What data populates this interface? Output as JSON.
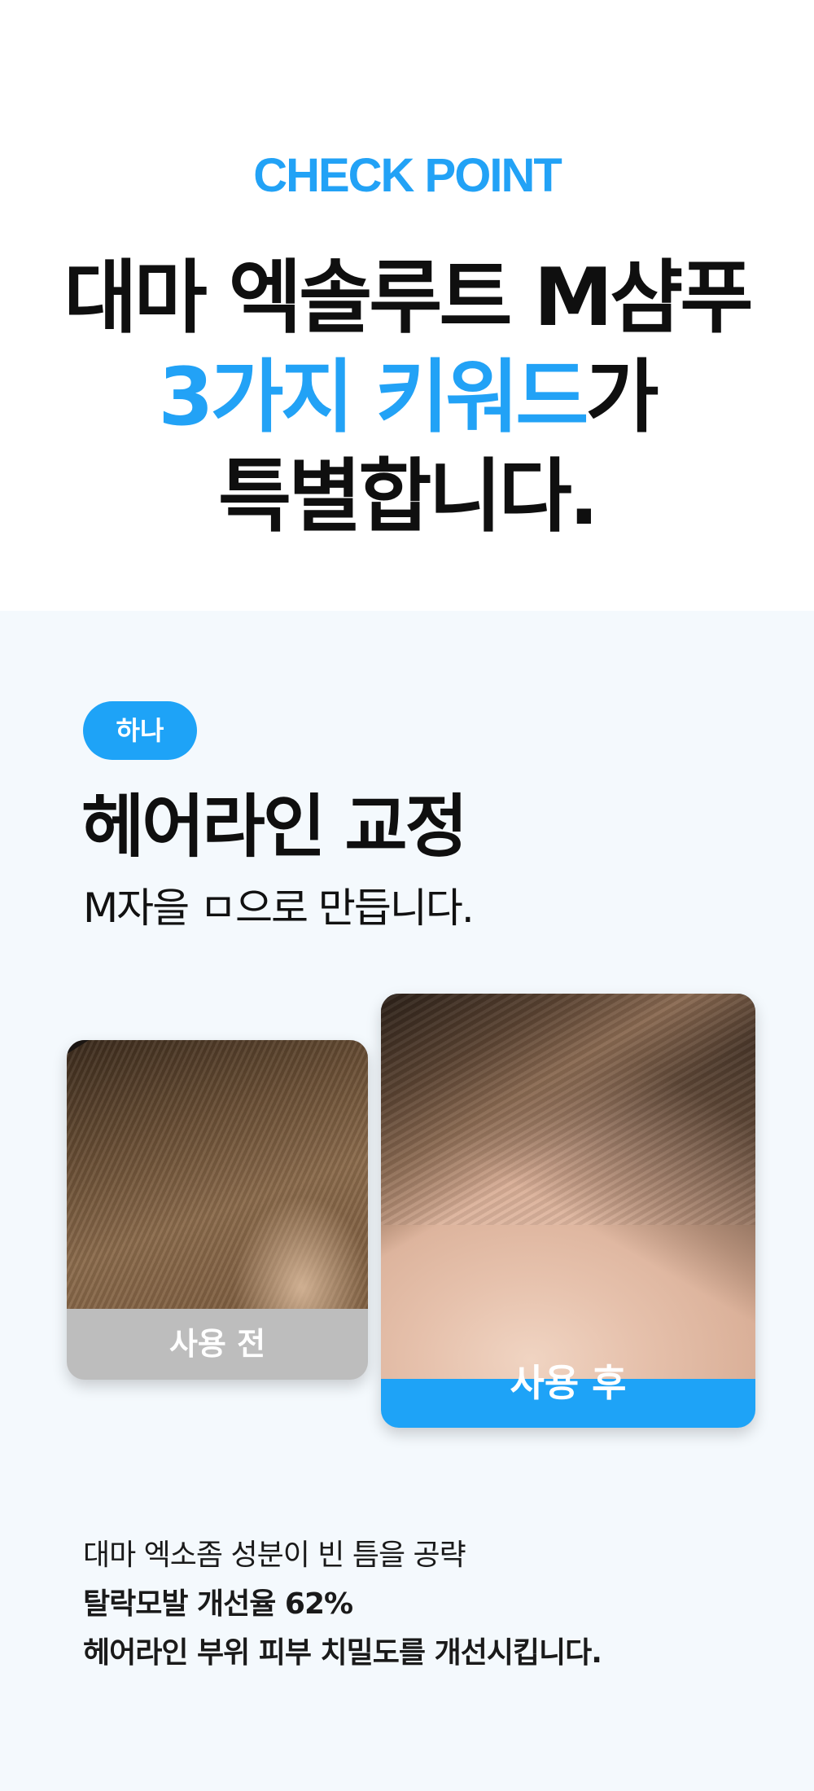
{
  "header": {
    "eyebrow": "CHECK POINT",
    "headline_line1": "대마 엑솔루트 M샴푸",
    "headline_line2_accent": "3가지 키워드",
    "headline_line2_rest": "가",
    "headline_line3": "특별합니다."
  },
  "point": {
    "badge": "하나",
    "title": "헤어라인 교정",
    "subtitle": "M자을 ㅁ으로 만듭니다.",
    "before_label": "사용 전",
    "after_label": "사용 후",
    "desc_line1": "대마 엑소좀 성분이 빈 틈을 공략",
    "desc_line2": "탈락모발 개선율 62%",
    "desc_line3": "헤어라인 부위 피부 치밀도를 개선시킵니다."
  },
  "colors": {
    "accent": "#22a2f6",
    "section_bg": "#f4f9fd",
    "before_label_bg": "#bdbdbd"
  }
}
